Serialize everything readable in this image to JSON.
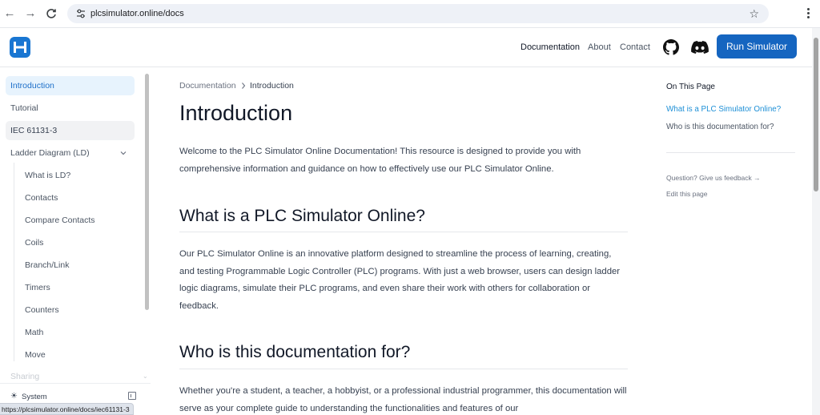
{
  "browser": {
    "url": "plcsimulator.online/docs",
    "status_url": "https://plcsimulator.online/docs/iec61131-3"
  },
  "header": {
    "nav": [
      "Documentation",
      "About",
      "Contact"
    ],
    "run_button": "Run Simulator",
    "accent_color": "#1565c0"
  },
  "sidebar": {
    "items": [
      "Introduction",
      "Tutorial",
      "IEC 61131-3",
      "Ladder Diagram (LD)"
    ],
    "ld_children": [
      "What is LD?",
      "Contacts",
      "Compare Contacts",
      "Coils",
      "Branch/Link",
      "Timers",
      "Counters",
      "Math",
      "Move"
    ],
    "faded_item": "Sharing",
    "theme_label": "System"
  },
  "breadcrumb": {
    "root": "Documentation",
    "current": "Introduction"
  },
  "content": {
    "title": "Introduction",
    "intro": "Welcome to the PLC Simulator Online Documentation! This resource is designed to provide you with comprehensive information and guidance on how to effectively use our PLC Simulator Online.",
    "h2_what": "What is a PLC Simulator Online?",
    "p_what": "Our PLC Simulator Online is an innovative platform designed to streamline the process of learning, creating, and testing Programmable Logic Controller (PLC) programs. With just a web browser, users can design ladder logic diagrams, simulate their PLC programs, and even share their work with others for collaboration or feedback.",
    "h2_who": "Who is this documentation for?",
    "p_who": "Whether you're a student, a teacher, a hobbyist, or a professional industrial programmer, this documentation will serve as your complete guide to understanding the functionalities and features of our"
  },
  "toc": {
    "title": "On This Page",
    "items": [
      "What is a PLC Simulator Online?",
      "Who is this documentation for?"
    ],
    "feedback": "Question? Give us feedback →",
    "edit": "Edit this page",
    "active_color": "#1d8fd6"
  }
}
